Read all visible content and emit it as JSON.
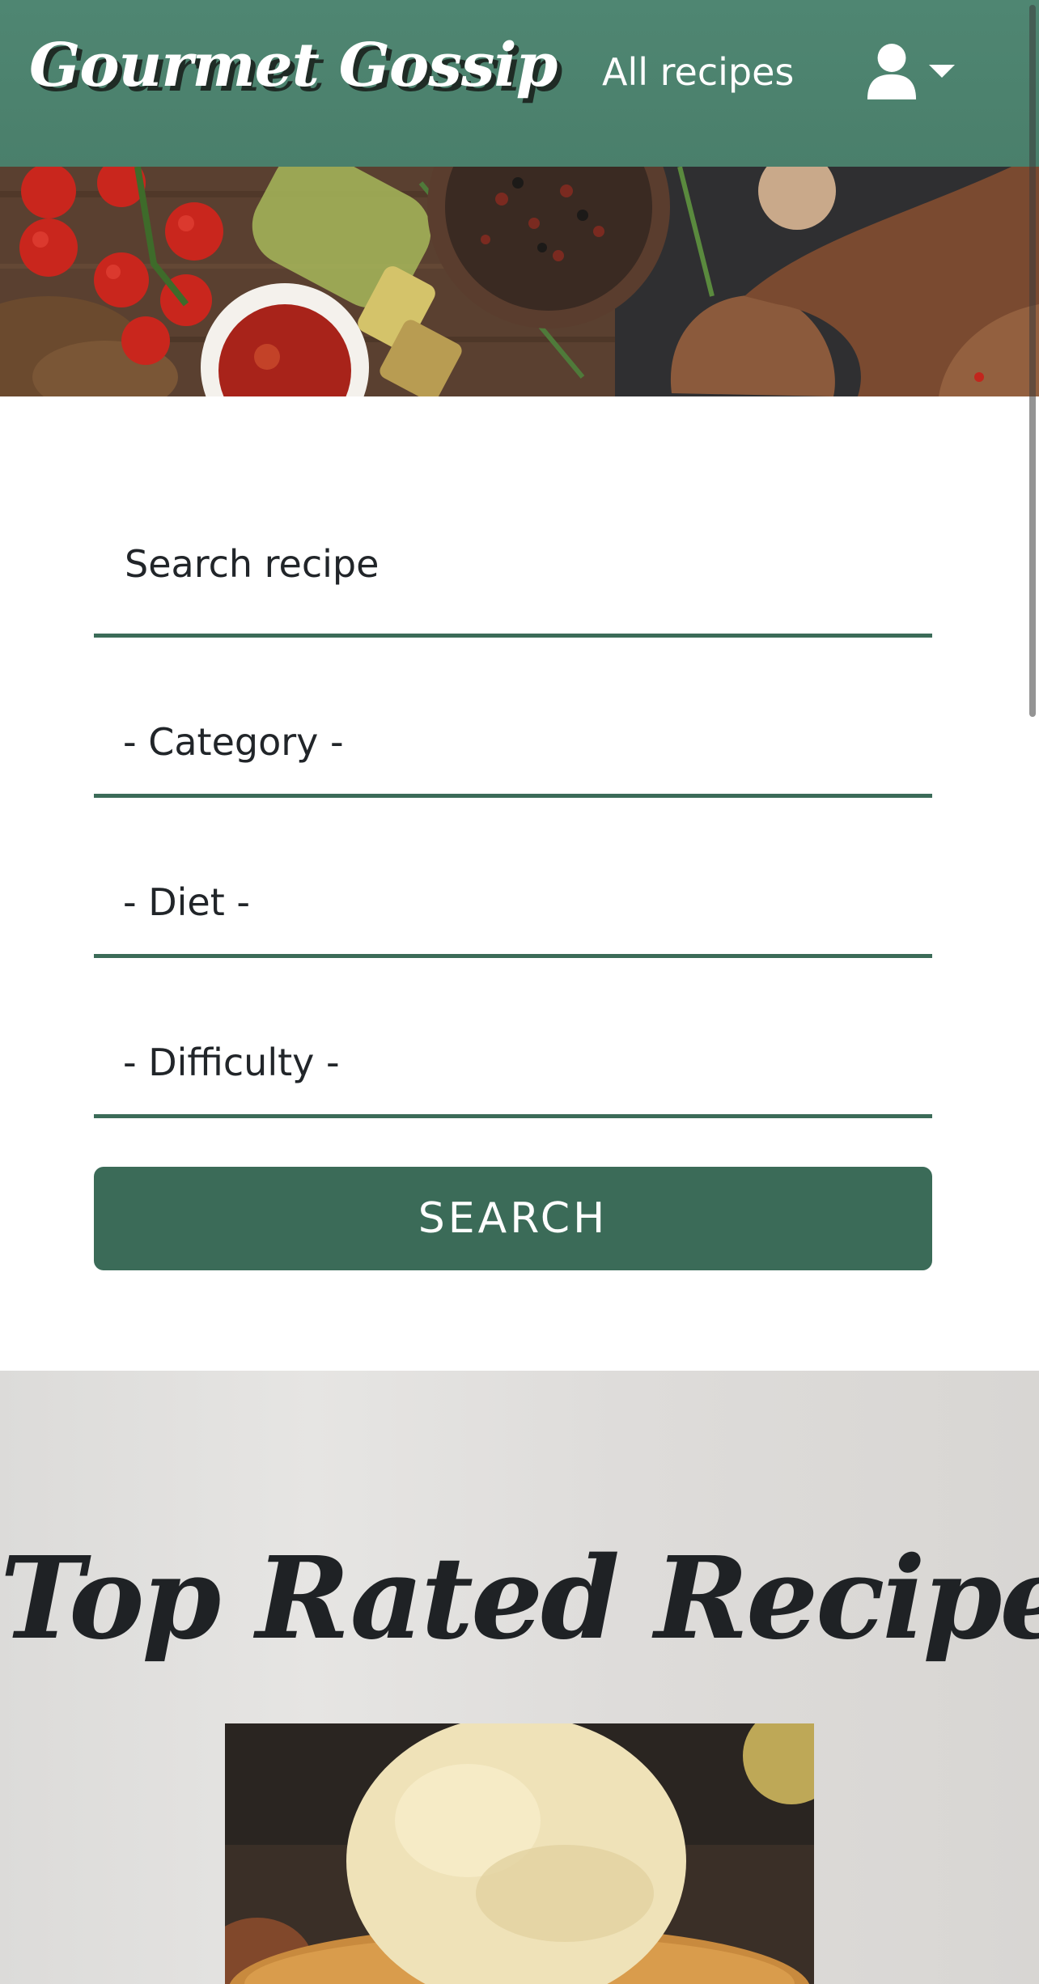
{
  "navbar": {
    "brand": "Gourmet Gossip",
    "nav_link": "All recipes",
    "user_icon": "user-icon",
    "caret_icon": "caret-down-icon",
    "background_color": "#4f8672"
  },
  "search_form": {
    "search_placeholder": "Search recipe",
    "category_label": "- Category -",
    "diet_label": "- Diet -",
    "difficulty_label": "- Difficulty -",
    "button_label": "SEARCH",
    "accent_color": "#3b6b58"
  },
  "top_rated": {
    "title": "Top Rated Recipes"
  }
}
